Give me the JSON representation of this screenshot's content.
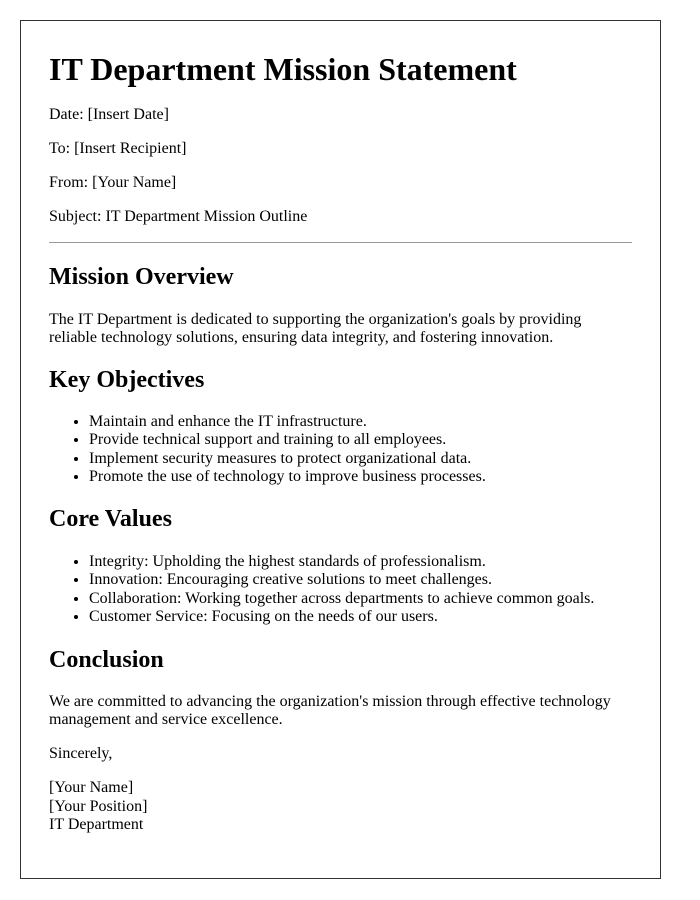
{
  "letter": {
    "title": "IT Department Mission Statement",
    "meta": {
      "date": "Date: [Insert Date]",
      "to": "To: [Insert Recipient]",
      "from": "From: [Your Name]",
      "subject": "Subject: IT Department Mission Outline"
    },
    "sections": {
      "overview": {
        "heading": "Mission Overview",
        "text": "The IT Department is dedicated to supporting the organization's goals by providing reliable technology solutions, ensuring data integrity, and fostering innovation."
      },
      "objectives": {
        "heading": "Key Objectives",
        "items": [
          "Maintain and enhance the IT infrastructure.",
          "Provide technical support and training to all employees.",
          "Implement security measures to protect organizational data.",
          "Promote the use of technology to improve business processes."
        ]
      },
      "values": {
        "heading": "Core Values",
        "items": [
          "Integrity: Upholding the highest standards of professionalism.",
          "Innovation: Encouraging creative solutions to meet challenges.",
          "Collaboration: Working together across departments to achieve common goals.",
          "Customer Service: Focusing on the needs of our users."
        ]
      },
      "conclusion": {
        "heading": "Conclusion",
        "text": "We are committed to advancing the organization's mission through effective technology management and service excellence."
      }
    },
    "closing": "Sincerely,",
    "signature": {
      "name": "[Your Name]",
      "position": "[Your Position]",
      "department": "IT Department"
    }
  }
}
